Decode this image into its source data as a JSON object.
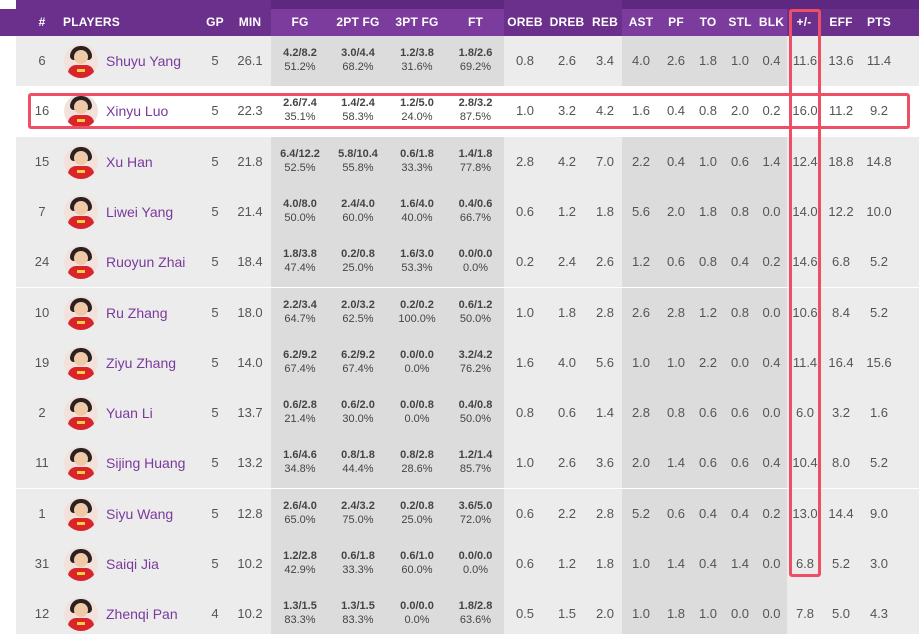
{
  "columns": {
    "num": "#",
    "players": "PLAYERS",
    "gp": "GP",
    "min": "MIN",
    "fg": "FG",
    "fg2": "2PT FG",
    "fg3": "3PT FG",
    "ft": "FT",
    "oreb": "OREB",
    "dreb": "DREB",
    "reb": "REB",
    "ast": "AST",
    "pf": "PF",
    "to": "TO",
    "stl": "STL",
    "blk": "BLK",
    "pm": "+/-",
    "eff": "EFF",
    "pts": "PTS"
  },
  "colors": {
    "header": "#6b2f8c",
    "player_name": "#7a3a9c",
    "highlight": "#ef4e67"
  },
  "avatar_icon": "player-headshot-icon",
  "players": [
    {
      "num": "6",
      "name": "Shuyu Yang",
      "gp": "5",
      "min": "26.1",
      "fg_m": "4.2/8.2",
      "fg_p": "51.2%",
      "fg2_m": "3.0/4.4",
      "fg2_p": "68.2%",
      "fg3_m": "1.2/3.8",
      "fg3_p": "31.6%",
      "ft_m": "1.8/2.6",
      "ft_p": "69.2%",
      "oreb": "0.8",
      "dreb": "2.6",
      "reb": "3.4",
      "ast": "4.0",
      "pf": "2.6",
      "to": "1.8",
      "stl": "1.0",
      "blk": "0.4",
      "pm": "11.6",
      "eff": "13.6",
      "pts": "11.4"
    },
    {
      "num": "16",
      "name": "Xinyu Luo",
      "gp": "5",
      "min": "22.3",
      "fg_m": "2.6/7.4",
      "fg_p": "35.1%",
      "fg2_m": "1.4/2.4",
      "fg2_p": "58.3%",
      "fg3_m": "1.2/5.0",
      "fg3_p": "24.0%",
      "ft_m": "2.8/3.2",
      "ft_p": "87.5%",
      "oreb": "1.0",
      "dreb": "3.2",
      "reb": "4.2",
      "ast": "1.6",
      "pf": "0.4",
      "to": "0.8",
      "stl": "2.0",
      "blk": "0.2",
      "pm": "16.0",
      "eff": "11.2",
      "pts": "9.2"
    },
    {
      "num": "15",
      "name": "Xu Han",
      "gp": "5",
      "min": "21.8",
      "fg_m": "6.4/12.2",
      "fg_p": "52.5%",
      "fg2_m": "5.8/10.4",
      "fg2_p": "55.8%",
      "fg3_m": "0.6/1.8",
      "fg3_p": "33.3%",
      "ft_m": "1.4/1.8",
      "ft_p": "77.8%",
      "oreb": "2.8",
      "dreb": "4.2",
      "reb": "7.0",
      "ast": "2.2",
      "pf": "0.4",
      "to": "1.0",
      "stl": "0.6",
      "blk": "1.4",
      "pm": "12.4",
      "eff": "18.8",
      "pts": "14.8"
    },
    {
      "num": "7",
      "name": "Liwei Yang",
      "gp": "5",
      "min": "21.4",
      "fg_m": "4.0/8.0",
      "fg_p": "50.0%",
      "fg2_m": "2.4/4.0",
      "fg2_p": "60.0%",
      "fg3_m": "1.6/4.0",
      "fg3_p": "40.0%",
      "ft_m": "0.4/0.6",
      "ft_p": "66.7%",
      "oreb": "0.6",
      "dreb": "1.2",
      "reb": "1.8",
      "ast": "5.6",
      "pf": "2.0",
      "to": "1.8",
      "stl": "0.8",
      "blk": "0.0",
      "pm": "14.0",
      "eff": "12.2",
      "pts": "10.0"
    },
    {
      "num": "24",
      "name": "Ruoyun Zhai",
      "gp": "5",
      "min": "18.4",
      "fg_m": "1.8/3.8",
      "fg_p": "47.4%",
      "fg2_m": "0.2/0.8",
      "fg2_p": "25.0%",
      "fg3_m": "1.6/3.0",
      "fg3_p": "53.3%",
      "ft_m": "0.0/0.0",
      "ft_p": "0.0%",
      "oreb": "0.2",
      "dreb": "2.4",
      "reb": "2.6",
      "ast": "1.2",
      "pf": "0.6",
      "to": "0.8",
      "stl": "0.4",
      "blk": "0.2",
      "pm": "14.6",
      "eff": "6.8",
      "pts": "5.2"
    },
    {
      "num": "10",
      "name": "Ru Zhang",
      "gp": "5",
      "min": "18.0",
      "fg_m": "2.2/3.4",
      "fg_p": "64.7%",
      "fg2_m": "2.0/3.2",
      "fg2_p": "62.5%",
      "fg3_m": "0.2/0.2",
      "fg3_p": "100.0%",
      "ft_m": "0.6/1.2",
      "ft_p": "50.0%",
      "oreb": "1.0",
      "dreb": "1.8",
      "reb": "2.8",
      "ast": "2.6",
      "pf": "2.8",
      "to": "1.2",
      "stl": "0.8",
      "blk": "0.0",
      "pm": "10.6",
      "eff": "8.4",
      "pts": "5.2"
    },
    {
      "num": "19",
      "name": "Ziyu Zhang",
      "gp": "5",
      "min": "14.0",
      "fg_m": "6.2/9.2",
      "fg_p": "67.4%",
      "fg2_m": "6.2/9.2",
      "fg2_p": "67.4%",
      "fg3_m": "0.0/0.0",
      "fg3_p": "0.0%",
      "ft_m": "3.2/4.2",
      "ft_p": "76.2%",
      "oreb": "1.6",
      "dreb": "4.0",
      "reb": "5.6",
      "ast": "1.0",
      "pf": "1.0",
      "to": "2.2",
      "stl": "0.0",
      "blk": "0.4",
      "pm": "11.4",
      "eff": "16.4",
      "pts": "15.6"
    },
    {
      "num": "2",
      "name": "Yuan Li",
      "gp": "5",
      "min": "13.7",
      "fg_m": "0.6/2.8",
      "fg_p": "21.4%",
      "fg2_m": "0.6/2.0",
      "fg2_p": "30.0%",
      "fg3_m": "0.0/0.8",
      "fg3_p": "0.0%",
      "ft_m": "0.4/0.8",
      "ft_p": "50.0%",
      "oreb": "0.8",
      "dreb": "0.6",
      "reb": "1.4",
      "ast": "2.8",
      "pf": "0.8",
      "to": "0.6",
      "stl": "0.6",
      "blk": "0.0",
      "pm": "6.0",
      "eff": "3.2",
      "pts": "1.6"
    },
    {
      "num": "11",
      "name": "Sijing Huang",
      "gp": "5",
      "min": "13.2",
      "fg_m": "1.6/4.6",
      "fg_p": "34.8%",
      "fg2_m": "0.8/1.8",
      "fg2_p": "44.4%",
      "fg3_m": "0.8/2.8",
      "fg3_p": "28.6%",
      "ft_m": "1.2/1.4",
      "ft_p": "85.7%",
      "oreb": "1.0",
      "dreb": "2.6",
      "reb": "3.6",
      "ast": "2.0",
      "pf": "1.4",
      "to": "0.6",
      "stl": "0.6",
      "blk": "0.4",
      "pm": "10.4",
      "eff": "8.0",
      "pts": "5.2"
    },
    {
      "num": "1",
      "name": "Siyu Wang",
      "gp": "5",
      "min": "12.8",
      "fg_m": "2.6/4.0",
      "fg_p": "65.0%",
      "fg2_m": "2.4/3.2",
      "fg2_p": "75.0%",
      "fg3_m": "0.2/0.8",
      "fg3_p": "25.0%",
      "ft_m": "3.6/5.0",
      "ft_p": "72.0%",
      "oreb": "0.6",
      "dreb": "2.2",
      "reb": "2.8",
      "ast": "5.2",
      "pf": "0.6",
      "to": "0.4",
      "stl": "0.4",
      "blk": "0.2",
      "pm": "13.0",
      "eff": "14.4",
      "pts": "9.0"
    },
    {
      "num": "31",
      "name": "Saiqi Jia",
      "gp": "5",
      "min": "10.2",
      "fg_m": "1.2/2.8",
      "fg_p": "42.9%",
      "fg2_m": "0.6/1.8",
      "fg2_p": "33.3%",
      "fg3_m": "0.6/1.0",
      "fg3_p": "60.0%",
      "ft_m": "0.0/0.0",
      "ft_p": "0.0%",
      "oreb": "0.6",
      "dreb": "1.2",
      "reb": "1.8",
      "ast": "1.0",
      "pf": "1.4",
      "to": "0.4",
      "stl": "1.4",
      "blk": "0.0",
      "pm": "6.8",
      "eff": "5.2",
      "pts": "3.0"
    },
    {
      "num": "12",
      "name": "Zhenqi Pan",
      "gp": "4",
      "min": "10.2",
      "fg_m": "1.3/1.5",
      "fg_p": "83.3%",
      "fg2_m": "1.3/1.5",
      "fg2_p": "83.3%",
      "fg3_m": "0.0/0.0",
      "fg3_p": "0.0%",
      "ft_m": "1.8/2.8",
      "ft_p": "63.6%",
      "oreb": "0.5",
      "dreb": "1.5",
      "reb": "2.0",
      "ast": "1.0",
      "pf": "1.8",
      "to": "1.0",
      "stl": "0.0",
      "blk": "0.0",
      "pm": "7.8",
      "eff": "5.0",
      "pts": "4.3"
    }
  ]
}
